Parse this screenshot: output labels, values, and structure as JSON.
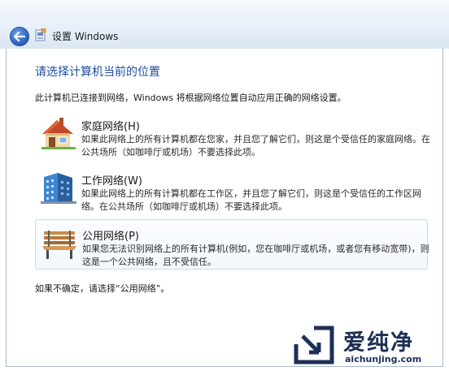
{
  "window": {
    "title": "设置 Windows"
  },
  "main": {
    "heading": "请选择计算机当前的位置",
    "intro": "此计算机已连接到网络，Windows 将根据网络位置自动应用正确的网络设置。",
    "options": [
      {
        "title": "家庭网络(H)",
        "desc_line1": "如果此网络上的所有计算机都在您家，并且您了解它们，则这是个受信任的家庭网络。在",
        "desc_line2": "公共场所（如咖啡厅或机场）不要选择此项。",
        "icon": "house-icon"
      },
      {
        "title": "工作网络(W)",
        "desc_line1": "如果此网络上的所有计算机都在工作区，并且您了解它们，则这是个受信任的工作区网",
        "desc_line2": "络。在公共场所（如咖啡厅或机场）不要选择此项。",
        "icon": "office-building-icon"
      },
      {
        "title": "公用网络(P)",
        "desc_line1": "如果您无法识别网络上的所有计算机(例如，您在咖啡厅或机场，或者您有移动宽带)，则",
        "desc_line2": "这是一个公共网络，且不受信任。",
        "icon": "park-bench-icon",
        "selected": true
      }
    ],
    "footer_note": "如果不确定，请选择“公用网络”。"
  },
  "watermark": {
    "title": "爱纯净",
    "url": "aichunjing.com"
  },
  "colors": {
    "heading": "#1e4d9c",
    "selection_border": "#c4dcef",
    "watermark": "#1d2f55"
  }
}
